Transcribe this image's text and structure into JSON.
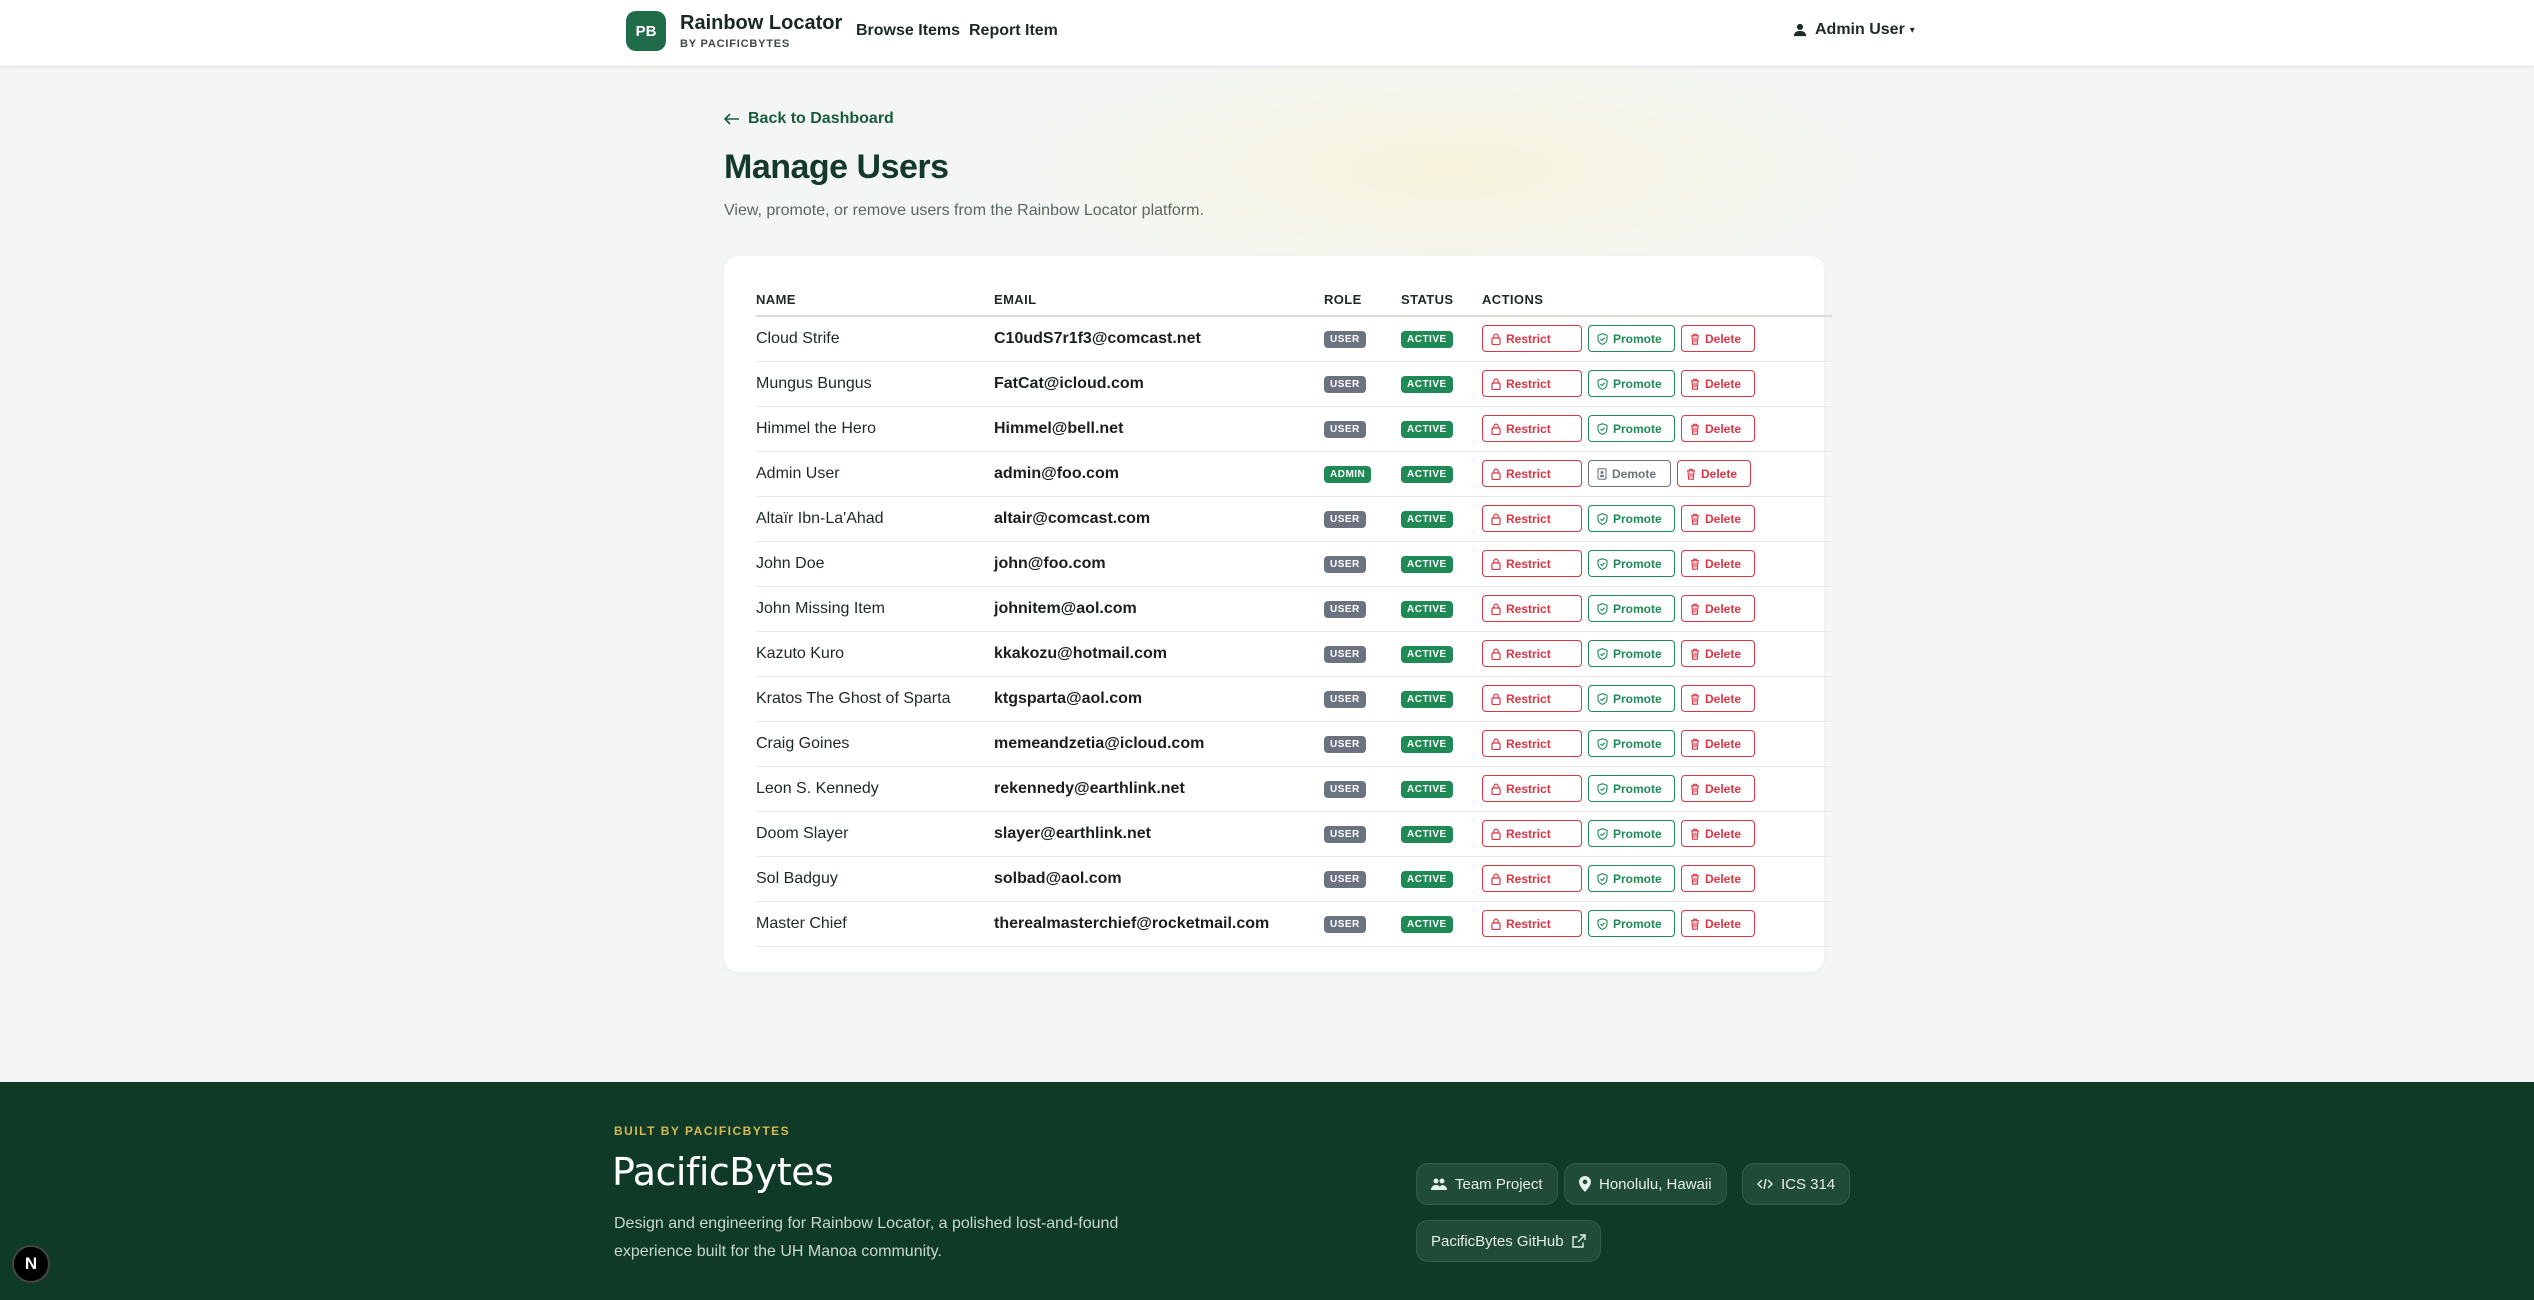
{
  "nav": {
    "logo_text": "PB",
    "brand_title": "Rainbow Locator",
    "brand_subtitle": "BY PACIFICBYTES",
    "links": [
      "Browse Items",
      "Report Item"
    ],
    "user_menu_label": "Admin User"
  },
  "page": {
    "back_link": "Back to Dashboard",
    "title": "Manage Users",
    "subtitle": "View, promote, or remove users from the Rainbow Locator platform."
  },
  "table": {
    "headers": [
      "NAME",
      "EMAIL",
      "ROLE",
      "STATUS",
      "ACTIONS"
    ],
    "rows": [
      {
        "name": "Cloud Strife",
        "email": "C10udS7r1f3@comcast.net",
        "role": "USER",
        "status": "ACTIVE",
        "actions": [
          "Restrict",
          "Promote",
          "Delete"
        ]
      },
      {
        "name": "Mungus Bungus",
        "email": "FatCat@icloud.com",
        "role": "USER",
        "status": "ACTIVE",
        "actions": [
          "Restrict",
          "Promote",
          "Delete"
        ]
      },
      {
        "name": "Himmel the Hero",
        "email": "Himmel@bell.net",
        "role": "USER",
        "status": "ACTIVE",
        "actions": [
          "Restrict",
          "Promote",
          "Delete"
        ]
      },
      {
        "name": "Admin User",
        "email": "admin@foo.com",
        "role": "ADMIN",
        "status": "ACTIVE",
        "actions": [
          "Restrict",
          "Demote",
          "Delete"
        ]
      },
      {
        "name": "Altaïr Ibn-La'Ahad",
        "email": "altair@comcast.com",
        "role": "USER",
        "status": "ACTIVE",
        "actions": [
          "Restrict",
          "Promote",
          "Delete"
        ]
      },
      {
        "name": "John Doe",
        "email": "john@foo.com",
        "role": "USER",
        "status": "ACTIVE",
        "actions": [
          "Restrict",
          "Promote",
          "Delete"
        ]
      },
      {
        "name": "John Missing Item",
        "email": "johnitem@aol.com",
        "role": "USER",
        "status": "ACTIVE",
        "actions": [
          "Restrict",
          "Promote",
          "Delete"
        ]
      },
      {
        "name": "Kazuto Kuro",
        "email": "kkakozu@hotmail.com",
        "role": "USER",
        "status": "ACTIVE",
        "actions": [
          "Restrict",
          "Promote",
          "Delete"
        ]
      },
      {
        "name": "Kratos The Ghost of Sparta",
        "email": "ktgsparta@aol.com",
        "role": "USER",
        "status": "ACTIVE",
        "actions": [
          "Restrict",
          "Promote",
          "Delete"
        ]
      },
      {
        "name": "Craig Goines",
        "email": "memeandzetia@icloud.com",
        "role": "USER",
        "status": "ACTIVE",
        "actions": [
          "Restrict",
          "Promote",
          "Delete"
        ]
      },
      {
        "name": "Leon S. Kennedy",
        "email": "rekennedy@earthlink.net",
        "role": "USER",
        "status": "ACTIVE",
        "actions": [
          "Restrict",
          "Promote",
          "Delete"
        ]
      },
      {
        "name": "Doom Slayer",
        "email": "slayer@earthlink.net",
        "role": "USER",
        "status": "ACTIVE",
        "actions": [
          "Restrict",
          "Promote",
          "Delete"
        ]
      },
      {
        "name": "Sol Badguy",
        "email": "solbad@aol.com",
        "role": "USER",
        "status": "ACTIVE",
        "actions": [
          "Restrict",
          "Promote",
          "Delete"
        ]
      },
      {
        "name": "Master Chief",
        "email": "therealmasterchief@rocketmail.com",
        "role": "USER",
        "status": "ACTIVE",
        "actions": [
          "Restrict",
          "Promote",
          "Delete"
        ]
      }
    ]
  },
  "footer": {
    "kicker": "BUILT BY PACIFICBYTES",
    "title": "PacificBytes",
    "description": "Design and engineering for Rainbow Locator, a polished lost-and-found experience built for the UH Manoa community.",
    "chips": {
      "team": "Team Project",
      "location": "Honolulu, Hawaii",
      "course": "ICS 314",
      "github": "PacificBytes GitHub"
    }
  },
  "dev_badge": "N",
  "colors": {
    "brand_green": "#1f6b4a",
    "footer_bg": "#0f3a27",
    "danger": "#dc3545",
    "success": "#1f8a55",
    "muted": "#6b7280",
    "accent_gold": "#d8b94f"
  },
  "icons": {
    "user_menu": "person-icon",
    "back": "arrow-left-icon",
    "restrict": "lock-icon",
    "promote": "shield-check-icon",
    "demote": "badge-icon",
    "delete": "trash-icon",
    "team": "people-icon",
    "location": "map-pin-icon",
    "course": "code-icon",
    "github": "external-link-icon"
  }
}
